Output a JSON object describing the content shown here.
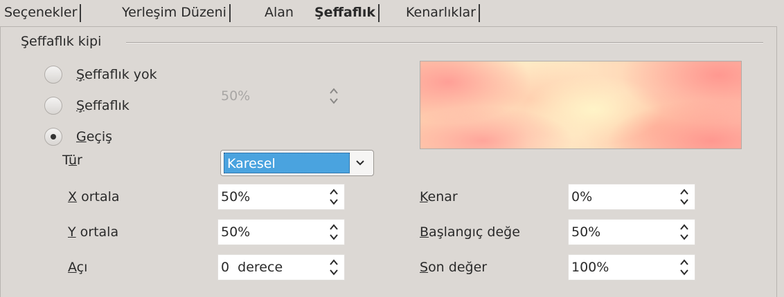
{
  "tabs": [
    {
      "label": "Seçenekler",
      "active": false
    },
    {
      "label": "Yerleşim Düzeni",
      "active": false
    },
    {
      "label": "Alan",
      "active": false
    },
    {
      "label": "Şeffaflık",
      "active": true
    },
    {
      "label": "Kenarlıklar",
      "active": false
    }
  ],
  "mode": {
    "group_label": "Şeffaflık kipi",
    "options": [
      {
        "pre": "",
        "ul": "Ş",
        "post": "effaflık yok",
        "selected": false
      },
      {
        "pre": "",
        "ul": "Ş",
        "post": "effaflık",
        "selected": false
      },
      {
        "pre": "",
        "ul": "G",
        "post": "eçiş",
        "selected": true
      }
    ],
    "transparency_value": "50%"
  },
  "gradient": {
    "type": {
      "pre": "T",
      "ul": "ü",
      "post": "r",
      "value": "Karesel"
    },
    "x_center": {
      "pre": "",
      "ul": "X",
      "post": " ortala",
      "value": "50%"
    },
    "y_center": {
      "pre": "",
      "ul": "Y",
      "post": " ortala",
      "value": "50%"
    },
    "angle": {
      "pre": "",
      "ul": "A",
      "post": "çı",
      "value": "0  derece"
    },
    "border": {
      "pre": "",
      "ul": "K",
      "post": "enar",
      "value": "0%"
    },
    "start_value": {
      "pre": "",
      "ul": "B",
      "post": "aşlangıç değe",
      "value": "50%"
    },
    "end_value": {
      "pre": "",
      "ul": "S",
      "post": "on değer",
      "value": "100%"
    }
  },
  "icons": {
    "spin": "up-down-chevron-icon",
    "dropdown": "chevron-down-icon",
    "radio": "radio-dot-icon"
  }
}
